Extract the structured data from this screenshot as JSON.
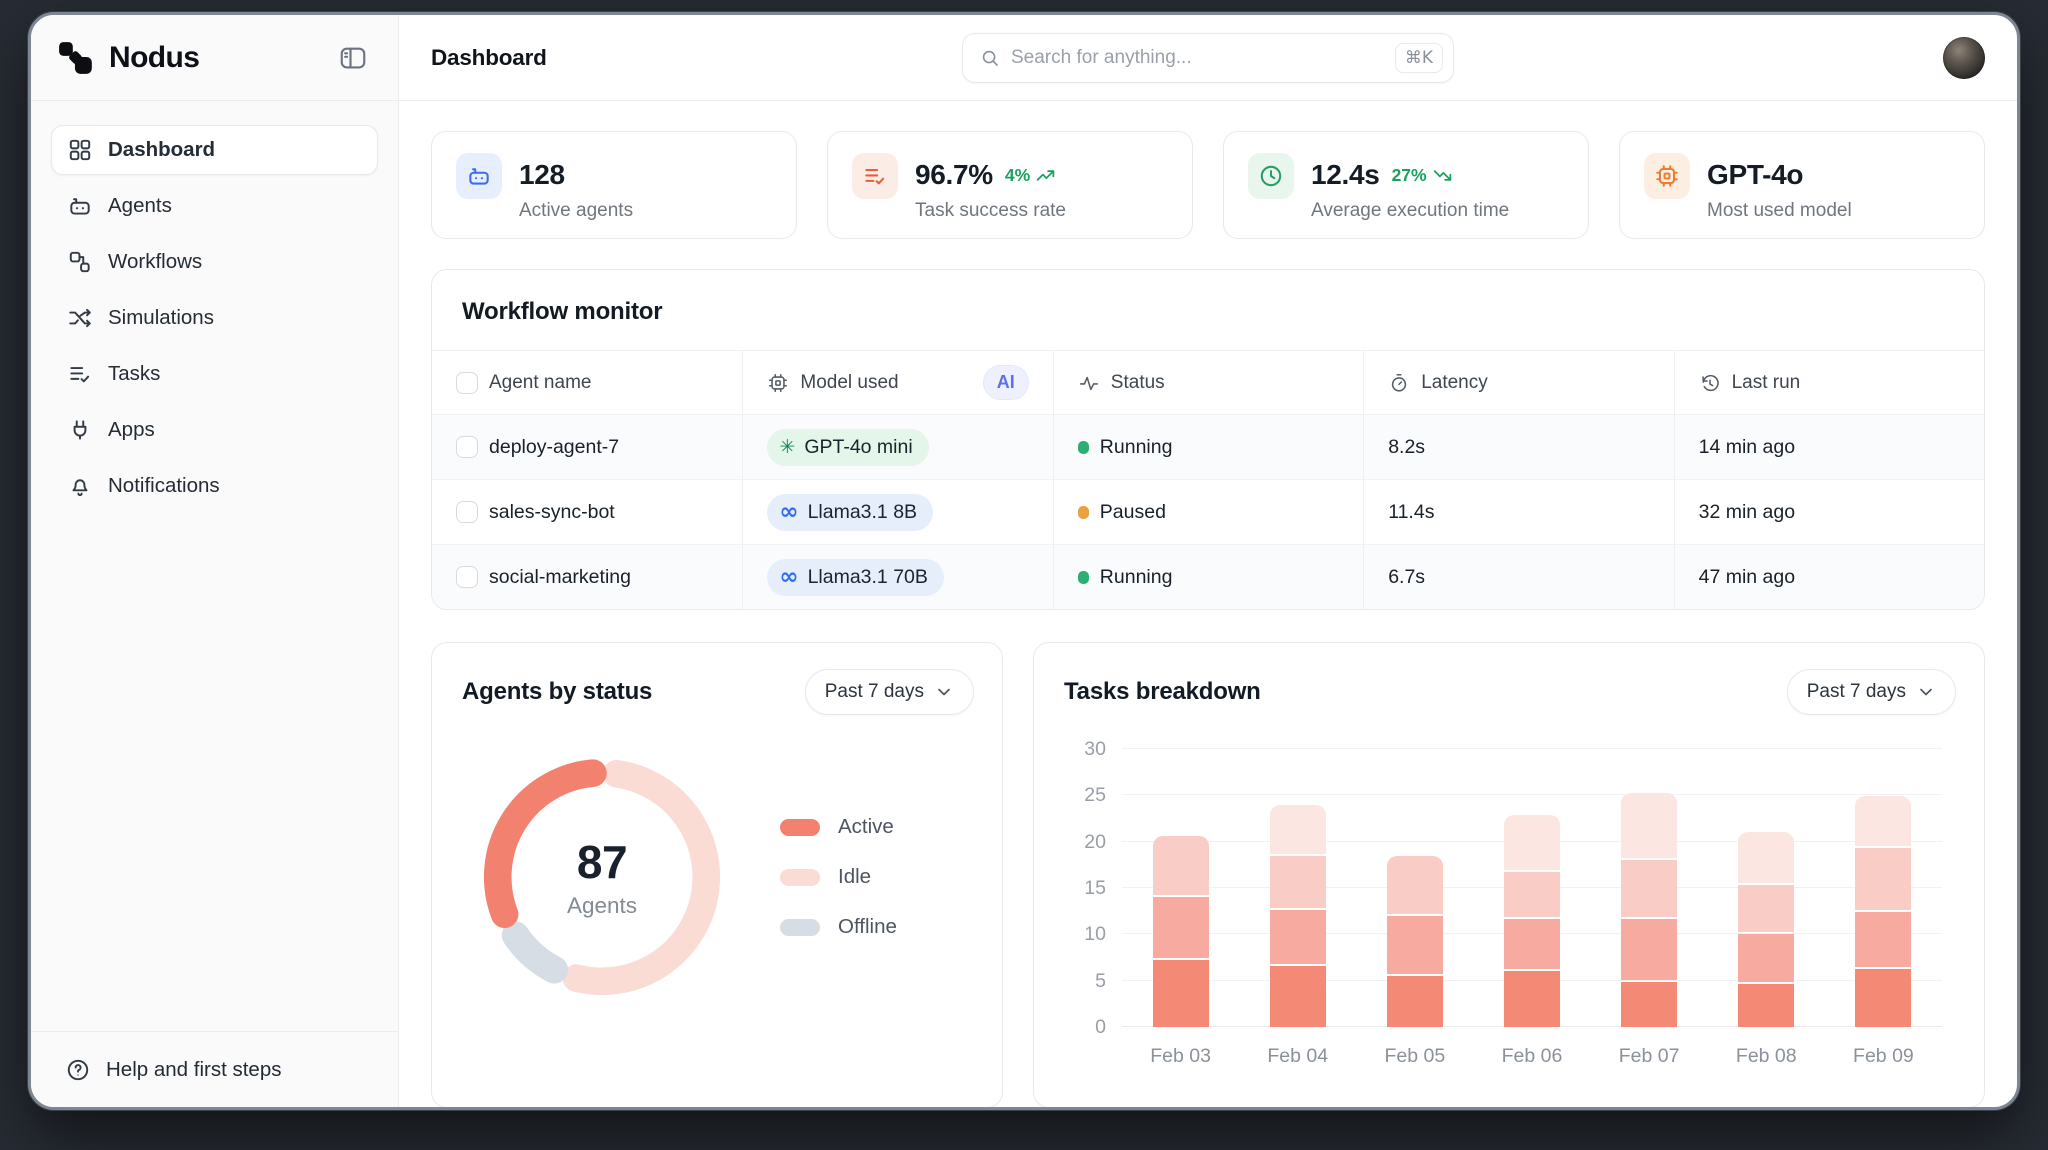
{
  "theme": {
    "accent": "#f2826f",
    "positive": "#17a35c",
    "bezel": "#272c34"
  },
  "brand": {
    "name": "Nodus"
  },
  "topbar": {
    "title": "Dashboard",
    "search_placeholder": "Search for anything...",
    "search_shortcut": "⌘K"
  },
  "sidebar": {
    "items": [
      {
        "label": "Dashboard"
      },
      {
        "label": "Agents"
      },
      {
        "label": "Workflows"
      },
      {
        "label": "Simulations"
      },
      {
        "label": "Tasks"
      },
      {
        "label": "Apps"
      },
      {
        "label": "Notifications"
      }
    ],
    "help_label": "Help and first steps"
  },
  "stats": [
    {
      "value": "128",
      "label": "Active agents",
      "icon": "robot-icon",
      "icon_color": "#3d6cf0",
      "icon_bg": "#e7effe"
    },
    {
      "value": "96.7%",
      "label": "Task success rate",
      "delta": "4%",
      "trend": "up",
      "delta_color": "#17a35c",
      "icon": "list-check-icon",
      "icon_color": "#e2603f",
      "icon_bg": "#fcece6"
    },
    {
      "value": "12.4s",
      "label": "Average execution time",
      "delta": "27%",
      "trend": "down",
      "delta_color": "#17a35c",
      "icon": "clock-icon",
      "icon_color": "#27a065",
      "icon_bg": "#e8f6ee"
    },
    {
      "value": "GPT-4o",
      "label": "Most used model",
      "icon": "cpu-icon",
      "icon_color": "#eb7d35",
      "icon_bg": "#fdeee2"
    }
  ],
  "workflow_monitor": {
    "title": "Workflow monitor",
    "ai_badge": "AI",
    "columns": [
      "Agent name",
      "Model used",
      "Status",
      "Latency",
      "Last run"
    ],
    "rows": [
      {
        "name": "deploy-agent-7",
        "model": "GPT-4o mini",
        "provider": "openai",
        "model_bg": "#e4f5e9",
        "model_glyph_color": "#108a54",
        "status": "Running",
        "status_color": "#2fae74",
        "latency": "8.2s",
        "last_run": "14 min ago"
      },
      {
        "name": "sales-sync-bot",
        "model": "Llama3.1 8B",
        "provider": "meta",
        "model_bg": "#e6eefc",
        "model_glyph_color": "#2f6cf6",
        "status": "Paused",
        "status_color": "#eaa23e",
        "latency": "11.4s",
        "last_run": "32 min ago"
      },
      {
        "name": "social-marketing",
        "model": "Llama3.1 70B",
        "provider": "meta",
        "model_bg": "#e6eefc",
        "model_glyph_color": "#2f6cf6",
        "status": "Running",
        "status_color": "#2fae74",
        "latency": "6.7s",
        "last_run": "47 min ago"
      }
    ]
  },
  "agents_by_status": {
    "title": "Agents by status",
    "range_label": "Past 7 days",
    "center_value": "87",
    "center_label": "Agents"
  },
  "tasks_breakdown": {
    "title": "Tasks breakdown",
    "range_label": "Past 7 days"
  },
  "chart_data": [
    {
      "type": "donut",
      "title": "Agents by status",
      "center_value": 87,
      "center_label": "Agents",
      "segments": [
        {
          "label": "Active",
          "value": 33,
          "color": "#f2826f"
        },
        {
          "label": "Idle",
          "value": 58,
          "color": "#fbdcd5"
        },
        {
          "label": "Offline",
          "value": 9,
          "color": "#d7dde4"
        }
      ],
      "draw_order": [
        "Idle",
        "Offline",
        "Active"
      ],
      "start_deg": 8,
      "gap_deg": 13,
      "legend_position": "right"
    },
    {
      "type": "stacked_bar",
      "title": "Tasks breakdown",
      "categories": [
        "Feb 03",
        "Feb 04",
        "Feb 05",
        "Feb 06",
        "Feb 07",
        "Feb 08",
        "Feb 09"
      ],
      "stacks": [
        [
          7.5,
          6.7,
          6.4,
          0
        ],
        [
          6.8,
          6.0,
          5.9,
          5.3
        ],
        [
          5.7,
          6.5,
          6.3,
          0
        ],
        [
          6.3,
          5.6,
          5.0,
          6.0
        ],
        [
          5.1,
          6.8,
          6.3,
          7.0
        ],
        [
          4.9,
          5.4,
          5.2,
          5.5
        ],
        [
          6.5,
          6.1,
          6.9,
          5.4
        ]
      ],
      "totals": [
        20.6,
        24.0,
        18.5,
        22.9,
        25.2,
        21.0,
        24.9
      ],
      "segment_colors": [
        "#f48a76",
        "#f7aba0",
        "#f9cdc6",
        "#fce6e2"
      ],
      "ylim": [
        0,
        30
      ],
      "yticks": [
        0,
        5,
        10,
        15,
        20,
        25,
        30
      ],
      "grid": true,
      "legend": false
    }
  ]
}
